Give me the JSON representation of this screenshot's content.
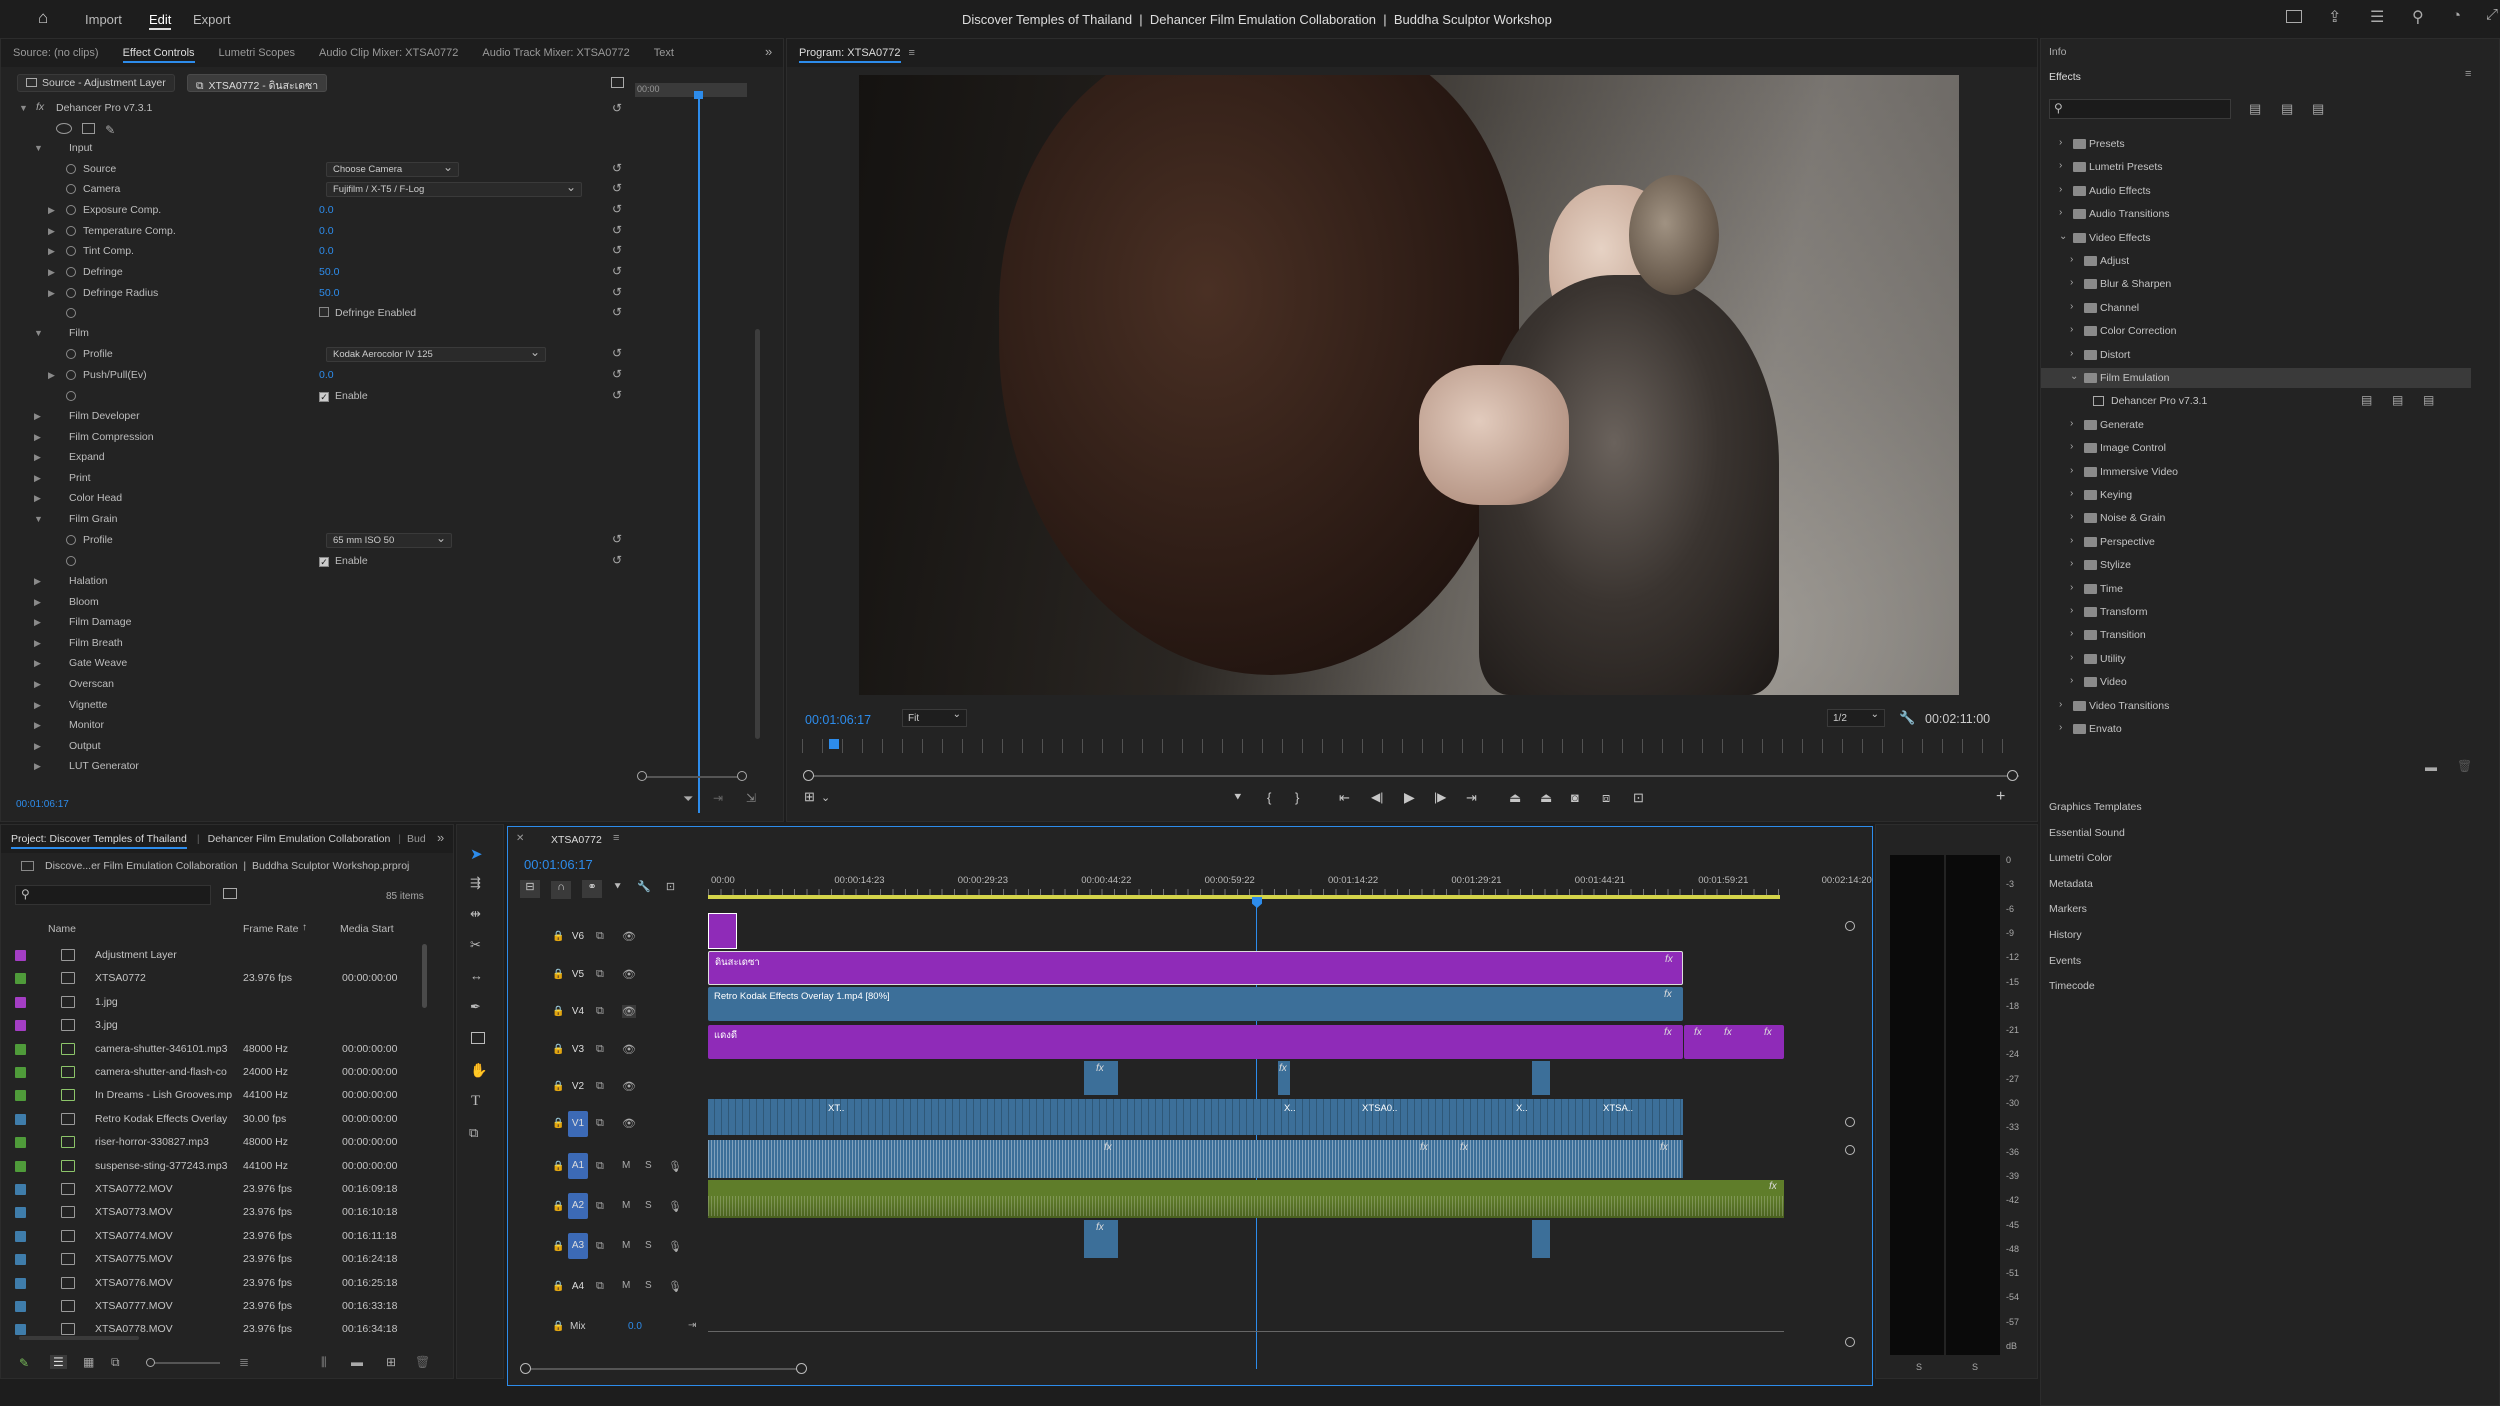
{
  "topbar": {
    "nav": [
      "Import",
      "Edit",
      "Export"
    ],
    "active_nav": "Edit",
    "title": "Discover Temples of Thailand  |  Dehancer Film Emulation Collaboration  |  Buddha Sculptor Workshop"
  },
  "source_panel": {
    "tabs": [
      "Source: (no clips)",
      "Effect Controls",
      "Lumetri Scopes",
      "Audio Clip Mixer: XTSA0772",
      "Audio Track Mixer: XTSA0772",
      "Text"
    ],
    "active_tab": "Effect Controls",
    "src_chip1": "Source - Adjustment Layer",
    "src_chip2": "XTSA0772 - ดินสะเดซา",
    "mini_time": "00:00",
    "plugin": "Dehancer Pro v7.3.1",
    "input_group": "Input",
    "params": [
      {
        "name": "Source",
        "type": "dropdown",
        "value": "Choose Camera"
      },
      {
        "name": "Camera",
        "type": "dropdown",
        "value": "Fujifilm / X-T5 / F-Log"
      },
      {
        "name": "Exposure Comp.",
        "type": "num",
        "value": "0.0"
      },
      {
        "name": "Temperature Comp.",
        "type": "num",
        "value": "0.0"
      },
      {
        "name": "Tint Comp.",
        "type": "num",
        "value": "0.0"
      },
      {
        "name": "Defringe",
        "type": "num",
        "value": "50.0"
      },
      {
        "name": "Defringe Radius",
        "type": "num",
        "value": "50.0"
      },
      {
        "name": "",
        "type": "check",
        "value": "Defringe Enabled"
      }
    ],
    "film_group": "Film",
    "film_params": [
      {
        "name": "Profile",
        "type": "dropdown",
        "value": "Kodak Aerocolor IV 125"
      },
      {
        "name": "Push/Pull(Ev)",
        "type": "num",
        "value": "0.0"
      },
      {
        "name": "",
        "type": "check",
        "value": "Enable"
      }
    ],
    "groups_a": [
      "Film Developer",
      "Film Compression",
      "Expand",
      "Print",
      "Color Head"
    ],
    "grain_group": "Film Grain",
    "grain_profile_label": "Profile",
    "grain_profile": "65 mm ISO 50",
    "grain_enable": "Enable",
    "groups_b": [
      "Halation",
      "Bloom",
      "Film Damage",
      "Film Breath",
      "Gate Weave",
      "Overscan",
      "Vignette",
      "Monitor",
      "Output",
      "LUT Generator"
    ],
    "timecode": "00:01:06:17"
  },
  "program": {
    "title": "Program: XTSA0772",
    "timecode": "00:01:06:17",
    "fit": "Fit",
    "res": "1/2",
    "duration": "00:02:11:00"
  },
  "effects_panel": {
    "info": "Info",
    "title": "Effects",
    "tree": [
      {
        "label": "Presets",
        "level": 0,
        "open": false
      },
      {
        "label": "Lumetri Presets",
        "level": 0,
        "open": false
      },
      {
        "label": "Audio Effects",
        "level": 0,
        "open": false
      },
      {
        "label": "Audio Transitions",
        "level": 0,
        "open": false
      },
      {
        "label": "Video Effects",
        "level": 0,
        "open": true
      },
      {
        "label": "Adjust",
        "level": 1,
        "open": false
      },
      {
        "label": "Blur & Sharpen",
        "level": 1,
        "open": false
      },
      {
        "label": "Channel",
        "level": 1,
        "open": false
      },
      {
        "label": "Color Correction",
        "level": 1,
        "open": false
      },
      {
        "label": "Distort",
        "level": 1,
        "open": false
      },
      {
        "label": "Film Emulation",
        "level": 1,
        "open": true,
        "selected": true
      },
      {
        "label": "Dehancer Pro v7.3.1",
        "level": 2,
        "open": false,
        "leaf": true
      },
      {
        "label": "Generate",
        "level": 1,
        "open": false
      },
      {
        "label": "Image Control",
        "level": 1,
        "open": false
      },
      {
        "label": "Immersive Video",
        "level": 1,
        "open": false
      },
      {
        "label": "Keying",
        "level": 1,
        "open": false
      },
      {
        "label": "Noise & Grain",
        "level": 1,
        "open": false
      },
      {
        "label": "Perspective",
        "level": 1,
        "open": false
      },
      {
        "label": "Stylize",
        "level": 1,
        "open": false
      },
      {
        "label": "Time",
        "level": 1,
        "open": false
      },
      {
        "label": "Transform",
        "level": 1,
        "open": false
      },
      {
        "label": "Transition",
        "level": 1,
        "open": false
      },
      {
        "label": "Utility",
        "level": 1,
        "open": false
      },
      {
        "label": "Video",
        "level": 1,
        "open": false
      },
      {
        "label": "Video Transitions",
        "level": 0,
        "open": false
      },
      {
        "label": "Envato",
        "level": 0,
        "open": false
      }
    ],
    "side_panels": [
      "Graphics Templates",
      "Essential Sound",
      "Lumetri Color",
      "Metadata",
      "Markers",
      "History",
      "Events",
      "Timecode"
    ]
  },
  "project": {
    "tabs": [
      "Project: Discover Temples of Thailand",
      "Dehancer Film Emulation Collaboration",
      "Bud"
    ],
    "path": "Discove...er Film Emulation Collaboration  |  Buddha Sculptor Workshop.prproj",
    "count": "85 items",
    "cols": [
      "Name",
      "Frame Rate",
      "Media Start"
    ],
    "items": [
      {
        "name": "Adjustment Layer",
        "rate": "",
        "start": "",
        "color": "#a43ec4"
      },
      {
        "name": "XTSA0772",
        "rate": "23.976 fps",
        "start": "00:00:00:00",
        "color": "#4f9b3a"
      },
      {
        "name": "1.jpg",
        "rate": "",
        "start": "",
        "color": "#a43ec4"
      },
      {
        "name": "3.jpg",
        "rate": "",
        "start": "",
        "color": "#a43ec4"
      },
      {
        "name": "camera-shutter-346101.mp3",
        "rate": "48000 Hz",
        "start": "00:00:00:00",
        "color": "#4f9b3a"
      },
      {
        "name": "camera-shutter-and-flash-co",
        "rate": "24000 Hz",
        "start": "00:00:00:00",
        "color": "#4f9b3a"
      },
      {
        "name": "In Dreams - Lish Grooves.mp",
        "rate": "44100 Hz",
        "start": "00:00:00:00",
        "color": "#4f9b3a"
      },
      {
        "name": "Retro Kodak Effects Overlay",
        "rate": "30.00 fps",
        "start": "00:00:00:00",
        "color": "#3f7dab"
      },
      {
        "name": "riser-horror-330827.mp3",
        "rate": "48000 Hz",
        "start": "00:00:00:00",
        "color": "#4f9b3a"
      },
      {
        "name": "suspense-sting-377243.mp3",
        "rate": "44100 Hz",
        "start": "00:00:00:00",
        "color": "#4f9b3a"
      },
      {
        "name": "XTSA0772.MOV",
        "rate": "23.976 fps",
        "start": "00:16:09:18",
        "color": "#3f7dab"
      },
      {
        "name": "XTSA0773.MOV",
        "rate": "23.976 fps",
        "start": "00:16:10:18",
        "color": "#3f7dab"
      },
      {
        "name": "XTSA0774.MOV",
        "rate": "23.976 fps",
        "start": "00:16:11:18",
        "color": "#3f7dab"
      },
      {
        "name": "XTSA0775.MOV",
        "rate": "23.976 fps",
        "start": "00:16:24:18",
        "color": "#3f7dab"
      },
      {
        "name": "XTSA0776.MOV",
        "rate": "23.976 fps",
        "start": "00:16:25:18",
        "color": "#3f7dab"
      },
      {
        "name": "XTSA0777.MOV",
        "rate": "23.976 fps",
        "start": "00:16:33:18",
        "color": "#3f7dab"
      },
      {
        "name": "XTSA0778.MOV",
        "rate": "23.976 fps",
        "start": "00:16:34:18",
        "color": "#3f7dab"
      }
    ]
  },
  "timeline": {
    "seq": "XTSA0772",
    "timecode": "00:01:06:17",
    "ruler": [
      "00:00",
      "00:00:14:23",
      "00:00:29:23",
      "00:00:44:22",
      "00:00:59:22",
      "00:01:14:22",
      "00:01:29:21",
      "00:01:44:21",
      "00:01:59:21",
      "00:02:14:20"
    ],
    "video_tracks": [
      "V6",
      "V5",
      "V4",
      "V3",
      "V2",
      "V1"
    ],
    "audio_tracks": [
      "A1",
      "A2",
      "A3",
      "A4"
    ],
    "mix_label": "Mix",
    "mix_value": "0.0",
    "clip_v5": "ดินสะเดซา",
    "clip_v4": "Retro Kodak Effects Overlay 1.mp4 [80%]",
    "clip_v3": "แดงดี",
    "v1_labels": [
      "XT..",
      "X..",
      "XTSA0..",
      "X..",
      "XTSA.."
    ],
    "fx": "fx",
    "mute": "M",
    "solo": "S"
  },
  "meters": {
    "scale": [
      "0",
      "-3",
      "-6",
      "-9",
      "-12",
      "-15",
      "-18",
      "-21",
      "-24",
      "-27",
      "-30",
      "-33",
      "-36",
      "-39",
      "-42",
      "-45",
      "-48",
      "-51",
      "-54",
      "-57",
      "dB"
    ],
    "s": "S"
  }
}
